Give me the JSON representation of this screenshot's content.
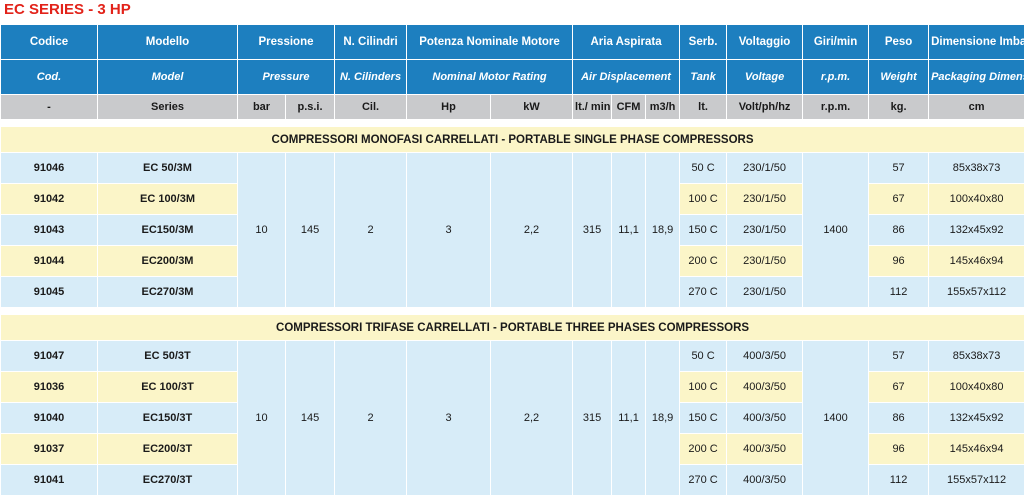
{
  "title": "EC SERIES - 3 HP",
  "headers": {
    "row1": {
      "code": "Codice",
      "model": "Modello",
      "pressure": "Pressione",
      "cylinders": "N. Cilindri",
      "motor": "Potenza Nominale Motore",
      "air": "Aria Aspirata",
      "tank": "Serb.",
      "voltage": "Voltaggio",
      "rpm": "Giri/min",
      "weight": "Peso",
      "dimension": "Dimensione Imballo"
    },
    "row2": {
      "code": "Cod.",
      "model": "Model",
      "pressure": "Pressure",
      "cylinders": "N. Cilinders",
      "motor": "Nominal Motor Rating",
      "air": "Air Displacement",
      "tank": "Tank",
      "voltage": "Voltage",
      "rpm": "r.p.m.",
      "weight": "Weight",
      "dimension": "Packaging Dimension"
    },
    "row3": {
      "code": "-",
      "model": "Series",
      "bar": "bar",
      "psi": "p.s.i.",
      "cyl": "Cil.",
      "hp": "Hp",
      "kw": "kW",
      "ltmin": "lt./ min.",
      "cfm": "CFM",
      "m3h": "m3/h",
      "tank": "lt.",
      "voltage": "Volt/ph/hz",
      "rpm": "r.p.m.",
      "weight": "kg.",
      "dimension": "cm"
    }
  },
  "sections": [
    {
      "title": "COMPRESSORI MONOFASI CARRELLATI - PORTABLE SINGLE PHASE COMPRESSORS",
      "shared": {
        "bar": "10",
        "psi": "145",
        "cyl": "2",
        "hp": "3",
        "kw": "2,2",
        "ltmin": "315",
        "cfm": "11,1",
        "m3h": "18,9",
        "rpm": "1400"
      },
      "rows": [
        {
          "code": "91046",
          "model": "EC 50/3M",
          "tank": "50 C",
          "voltage": "230/1/50",
          "weight": "57",
          "dim": "85x38x73"
        },
        {
          "code": "91042",
          "model": "EC 100/3M",
          "tank": "100 C",
          "voltage": "230/1/50",
          "weight": "67",
          "dim": "100x40x80"
        },
        {
          "code": "91043",
          "model": "EC150/3M",
          "tank": "150 C",
          "voltage": "230/1/50",
          "weight": "86",
          "dim": "132x45x92"
        },
        {
          "code": "91044",
          "model": "EC200/3M",
          "tank": "200 C",
          "voltage": "230/1/50",
          "weight": "96",
          "dim": "145x46x94"
        },
        {
          "code": "91045",
          "model": "EC270/3M",
          "tank": "270 C",
          "voltage": "230/1/50",
          "weight": "112",
          "dim": "155x57x112"
        }
      ]
    },
    {
      "title": "COMPRESSORI TRIFASE CARRELLATI - PORTABLE THREE PHASES COMPRESSORS",
      "shared": {
        "bar": "10",
        "psi": "145",
        "cyl": "2",
        "hp": "3",
        "kw": "2,2",
        "ltmin": "315",
        "cfm": "11,1",
        "m3h": "18,9",
        "rpm": "1400"
      },
      "rows": [
        {
          "code": "91047",
          "model": "EC 50/3T",
          "tank": "50 C",
          "voltage": "400/3/50",
          "weight": "57",
          "dim": "85x38x73"
        },
        {
          "code": "91036",
          "model": "EC 100/3T",
          "tank": "100 C",
          "voltage": "400/3/50",
          "weight": "67",
          "dim": "100x40x80"
        },
        {
          "code": "91040",
          "model": "EC150/3T",
          "tank": "150 C",
          "voltage": "400/3/50",
          "weight": "86",
          "dim": "132x45x92"
        },
        {
          "code": "91037",
          "model": "EC200/3T",
          "tank": "200 C",
          "voltage": "400/3/50",
          "weight": "96",
          "dim": "145x46x94"
        },
        {
          "code": "91041",
          "model": "EC270/3T",
          "tank": "270 C",
          "voltage": "400/3/50",
          "weight": "112",
          "dim": "155x57x112"
        }
      ]
    }
  ]
}
